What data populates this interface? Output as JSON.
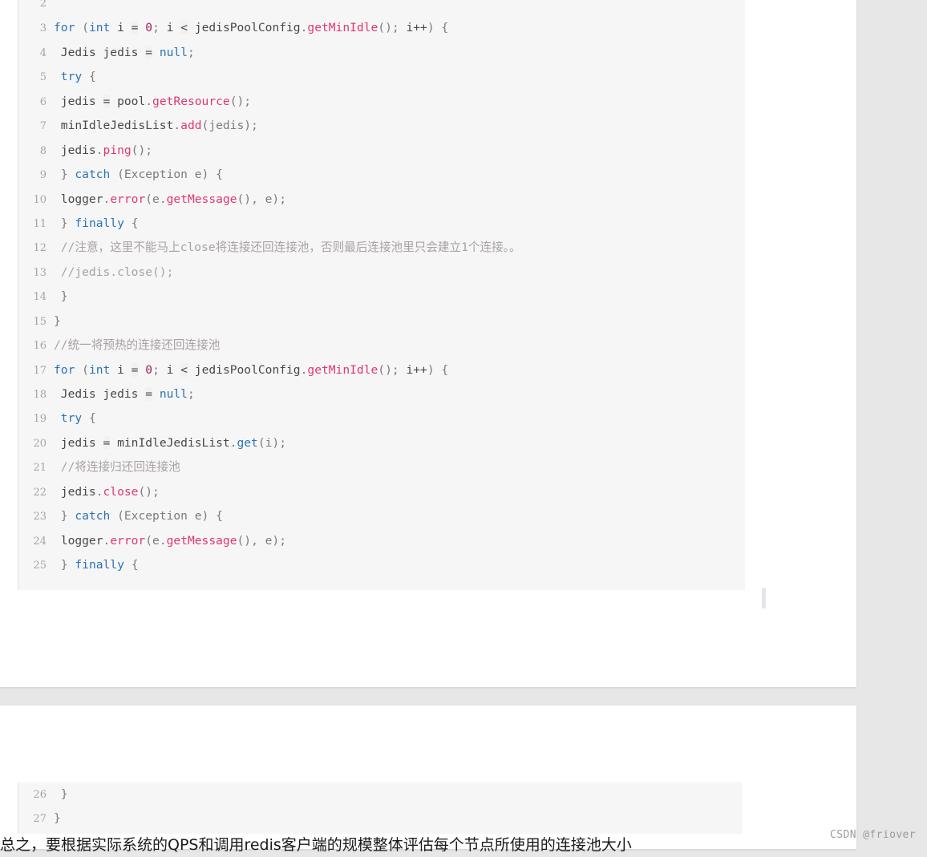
{
  "page": {
    "background_color": "#e7e7e7",
    "card_color": "#ffffff",
    "code_background": "#f6f6f6"
  },
  "watermark": {
    "text": "CSDN @friover"
  },
  "paragraph": {
    "text": "总之，要根据实际系统的QPS和调用redis客户端的规模整体评估每个节点所使用的连接池大小"
  },
  "code_block_top": {
    "language": "java",
    "first_visible_line": 2,
    "lines": [
      {
        "no": "2",
        "tokens": []
      },
      {
        "no": "3",
        "tokens": [
          {
            "t": "for",
            "c": "kw"
          },
          {
            "t": " ",
            "c": "pun"
          },
          {
            "t": "(",
            "c": "pun"
          },
          {
            "t": "int",
            "c": "kw"
          },
          {
            "t": " i ",
            "c": "typ"
          },
          {
            "t": "=",
            "c": "op"
          },
          {
            "t": " ",
            "c": "typ"
          },
          {
            "t": "0",
            "c": "num"
          },
          {
            "t": ";",
            "c": "pun"
          },
          {
            "t": " i ",
            "c": "typ"
          },
          {
            "t": "<",
            "c": "op"
          },
          {
            "t": " jedisPoolConfig",
            "c": "typ"
          },
          {
            "t": ".",
            "c": "pun"
          },
          {
            "t": "getMinIdle",
            "c": "fn"
          },
          {
            "t": "()",
            "c": "pun"
          },
          {
            "t": ";",
            "c": "pun"
          },
          {
            "t": " i++",
            "c": "typ"
          },
          {
            "t": ")",
            "c": "pun"
          },
          {
            "t": " ",
            "c": "typ"
          },
          {
            "t": "{",
            "c": "pun"
          }
        ]
      },
      {
        "no": "4",
        "tokens": [
          {
            "t": " Jedis jedis ",
            "c": "typ"
          },
          {
            "t": "=",
            "c": "op"
          },
          {
            "t": " ",
            "c": "typ"
          },
          {
            "t": "null",
            "c": "kw"
          },
          {
            "t": ";",
            "c": "pun"
          }
        ]
      },
      {
        "no": "5",
        "tokens": [
          {
            "t": " ",
            "c": "typ"
          },
          {
            "t": "try",
            "c": "kw"
          },
          {
            "t": " ",
            "c": "typ"
          },
          {
            "t": "{",
            "c": "pun"
          }
        ]
      },
      {
        "no": "6",
        "tokens": [
          {
            "t": " jedis ",
            "c": "typ"
          },
          {
            "t": "=",
            "c": "op"
          },
          {
            "t": " pool",
            "c": "typ"
          },
          {
            "t": ".",
            "c": "pun"
          },
          {
            "t": "getResource",
            "c": "fn"
          },
          {
            "t": "()",
            "c": "pun"
          },
          {
            "t": ";",
            "c": "pun"
          }
        ]
      },
      {
        "no": "7",
        "tokens": [
          {
            "t": " minIdleJedisList",
            "c": "typ"
          },
          {
            "t": ".",
            "c": "pun"
          },
          {
            "t": "add",
            "c": "fn"
          },
          {
            "t": "(jedis)",
            "c": "pun"
          },
          {
            "t": ";",
            "c": "pun"
          }
        ]
      },
      {
        "no": "8",
        "tokens": [
          {
            "t": " jedis",
            "c": "typ"
          },
          {
            "t": ".",
            "c": "pun"
          },
          {
            "t": "ping",
            "c": "fn"
          },
          {
            "t": "()",
            "c": "pun"
          },
          {
            "t": ";",
            "c": "pun"
          }
        ]
      },
      {
        "no": "9",
        "tokens": [
          {
            "t": " }",
            "c": "pun"
          },
          {
            "t": " ",
            "c": "typ"
          },
          {
            "t": "catch",
            "c": "kw"
          },
          {
            "t": " (Exception e) {",
            "c": "pun"
          }
        ]
      },
      {
        "no": "10",
        "tokens": [
          {
            "t": " logger",
            "c": "typ"
          },
          {
            "t": ".",
            "c": "pun"
          },
          {
            "t": "error",
            "c": "fn"
          },
          {
            "t": "(e",
            "c": "pun"
          },
          {
            "t": ".",
            "c": "pun"
          },
          {
            "t": "getMessage",
            "c": "fn"
          },
          {
            "t": "(), e)",
            "c": "pun"
          },
          {
            "t": ";",
            "c": "pun"
          }
        ]
      },
      {
        "no": "11",
        "tokens": [
          {
            "t": " }",
            "c": "pun"
          },
          {
            "t": " ",
            "c": "typ"
          },
          {
            "t": "finally",
            "c": "kw"
          },
          {
            "t": " ",
            "c": "typ"
          },
          {
            "t": "{",
            "c": "pun"
          }
        ]
      },
      {
        "no": "12",
        "tokens": [
          {
            "t": " //注意，这里不能马上close将连接还回连接池，否则最后连接池里只会建立1个连接。。",
            "c": "cmt"
          }
        ]
      },
      {
        "no": "13",
        "tokens": [
          {
            "t": " //jedis.close();",
            "c": "cmt"
          }
        ]
      },
      {
        "no": "14",
        "tokens": [
          {
            "t": " }",
            "c": "pun"
          }
        ]
      },
      {
        "no": "15",
        "tokens": [
          {
            "t": "}",
            "c": "pun"
          }
        ]
      },
      {
        "no": "16",
        "tokens": [
          {
            "t": "//统一将预热的连接还回连接池",
            "c": "cmt"
          }
        ]
      },
      {
        "no": "17",
        "tokens": [
          {
            "t": "for",
            "c": "kw"
          },
          {
            "t": " ",
            "c": "pun"
          },
          {
            "t": "(",
            "c": "pun"
          },
          {
            "t": "int",
            "c": "kw"
          },
          {
            "t": " i ",
            "c": "typ"
          },
          {
            "t": "=",
            "c": "op"
          },
          {
            "t": " ",
            "c": "typ"
          },
          {
            "t": "0",
            "c": "num"
          },
          {
            "t": ";",
            "c": "pun"
          },
          {
            "t": " i ",
            "c": "typ"
          },
          {
            "t": "<",
            "c": "op"
          },
          {
            "t": " jedisPoolConfig",
            "c": "typ"
          },
          {
            "t": ".",
            "c": "pun"
          },
          {
            "t": "getMinIdle",
            "c": "fn"
          },
          {
            "t": "()",
            "c": "pun"
          },
          {
            "t": ";",
            "c": "pun"
          },
          {
            "t": " i++",
            "c": "typ"
          },
          {
            "t": ")",
            "c": "pun"
          },
          {
            "t": " ",
            "c": "typ"
          },
          {
            "t": "{",
            "c": "pun"
          }
        ]
      },
      {
        "no": "18",
        "tokens": [
          {
            "t": " Jedis jedis ",
            "c": "typ"
          },
          {
            "t": "=",
            "c": "op"
          },
          {
            "t": " ",
            "c": "typ"
          },
          {
            "t": "null",
            "c": "kw"
          },
          {
            "t": ";",
            "c": "pun"
          }
        ]
      },
      {
        "no": "19",
        "tokens": [
          {
            "t": " ",
            "c": "typ"
          },
          {
            "t": "try",
            "c": "kw"
          },
          {
            "t": " ",
            "c": "typ"
          },
          {
            "t": "{",
            "c": "pun"
          }
        ]
      },
      {
        "no": "20",
        "tokens": [
          {
            "t": " jedis ",
            "c": "typ"
          },
          {
            "t": "=",
            "c": "op"
          },
          {
            "t": " minIdleJedisList",
            "c": "typ"
          },
          {
            "t": ".",
            "c": "pun"
          },
          {
            "t": "get",
            "c": "fn2"
          },
          {
            "t": "(i)",
            "c": "pun"
          },
          {
            "t": ";",
            "c": "pun"
          }
        ]
      },
      {
        "no": "21",
        "tokens": [
          {
            "t": " //将连接归还回连接池",
            "c": "cmt"
          }
        ]
      },
      {
        "no": "22",
        "tokens": [
          {
            "t": " jedis",
            "c": "typ"
          },
          {
            "t": ".",
            "c": "pun"
          },
          {
            "t": "close",
            "c": "fn"
          },
          {
            "t": "()",
            "c": "pun"
          },
          {
            "t": ";",
            "c": "pun"
          }
        ]
      },
      {
        "no": "23",
        "tokens": [
          {
            "t": " }",
            "c": "pun"
          },
          {
            "t": " ",
            "c": "typ"
          },
          {
            "t": "catch",
            "c": "kw"
          },
          {
            "t": " (Exception e) {",
            "c": "pun"
          }
        ]
      },
      {
        "no": "24",
        "tokens": [
          {
            "t": " logger",
            "c": "typ"
          },
          {
            "t": ".",
            "c": "pun"
          },
          {
            "t": "error",
            "c": "fn"
          },
          {
            "t": "(e",
            "c": "pun"
          },
          {
            "t": ".",
            "c": "pun"
          },
          {
            "t": "getMessage",
            "c": "fn"
          },
          {
            "t": "(), e)",
            "c": "pun"
          },
          {
            "t": ";",
            "c": "pun"
          }
        ]
      },
      {
        "no": "25",
        "tokens": [
          {
            "t": " }",
            "c": "pun"
          },
          {
            "t": " ",
            "c": "typ"
          },
          {
            "t": "finally",
            "c": "kw"
          },
          {
            "t": " ",
            "c": "typ"
          },
          {
            "t": "{",
            "c": "pun"
          }
        ]
      }
    ]
  },
  "code_block_bottom": {
    "language": "java",
    "lines": [
      {
        "no": "26",
        "tokens": [
          {
            "t": " }",
            "c": "pun"
          }
        ]
      },
      {
        "no": "27",
        "tokens": [
          {
            "t": "}",
            "c": "pun"
          }
        ]
      }
    ]
  }
}
